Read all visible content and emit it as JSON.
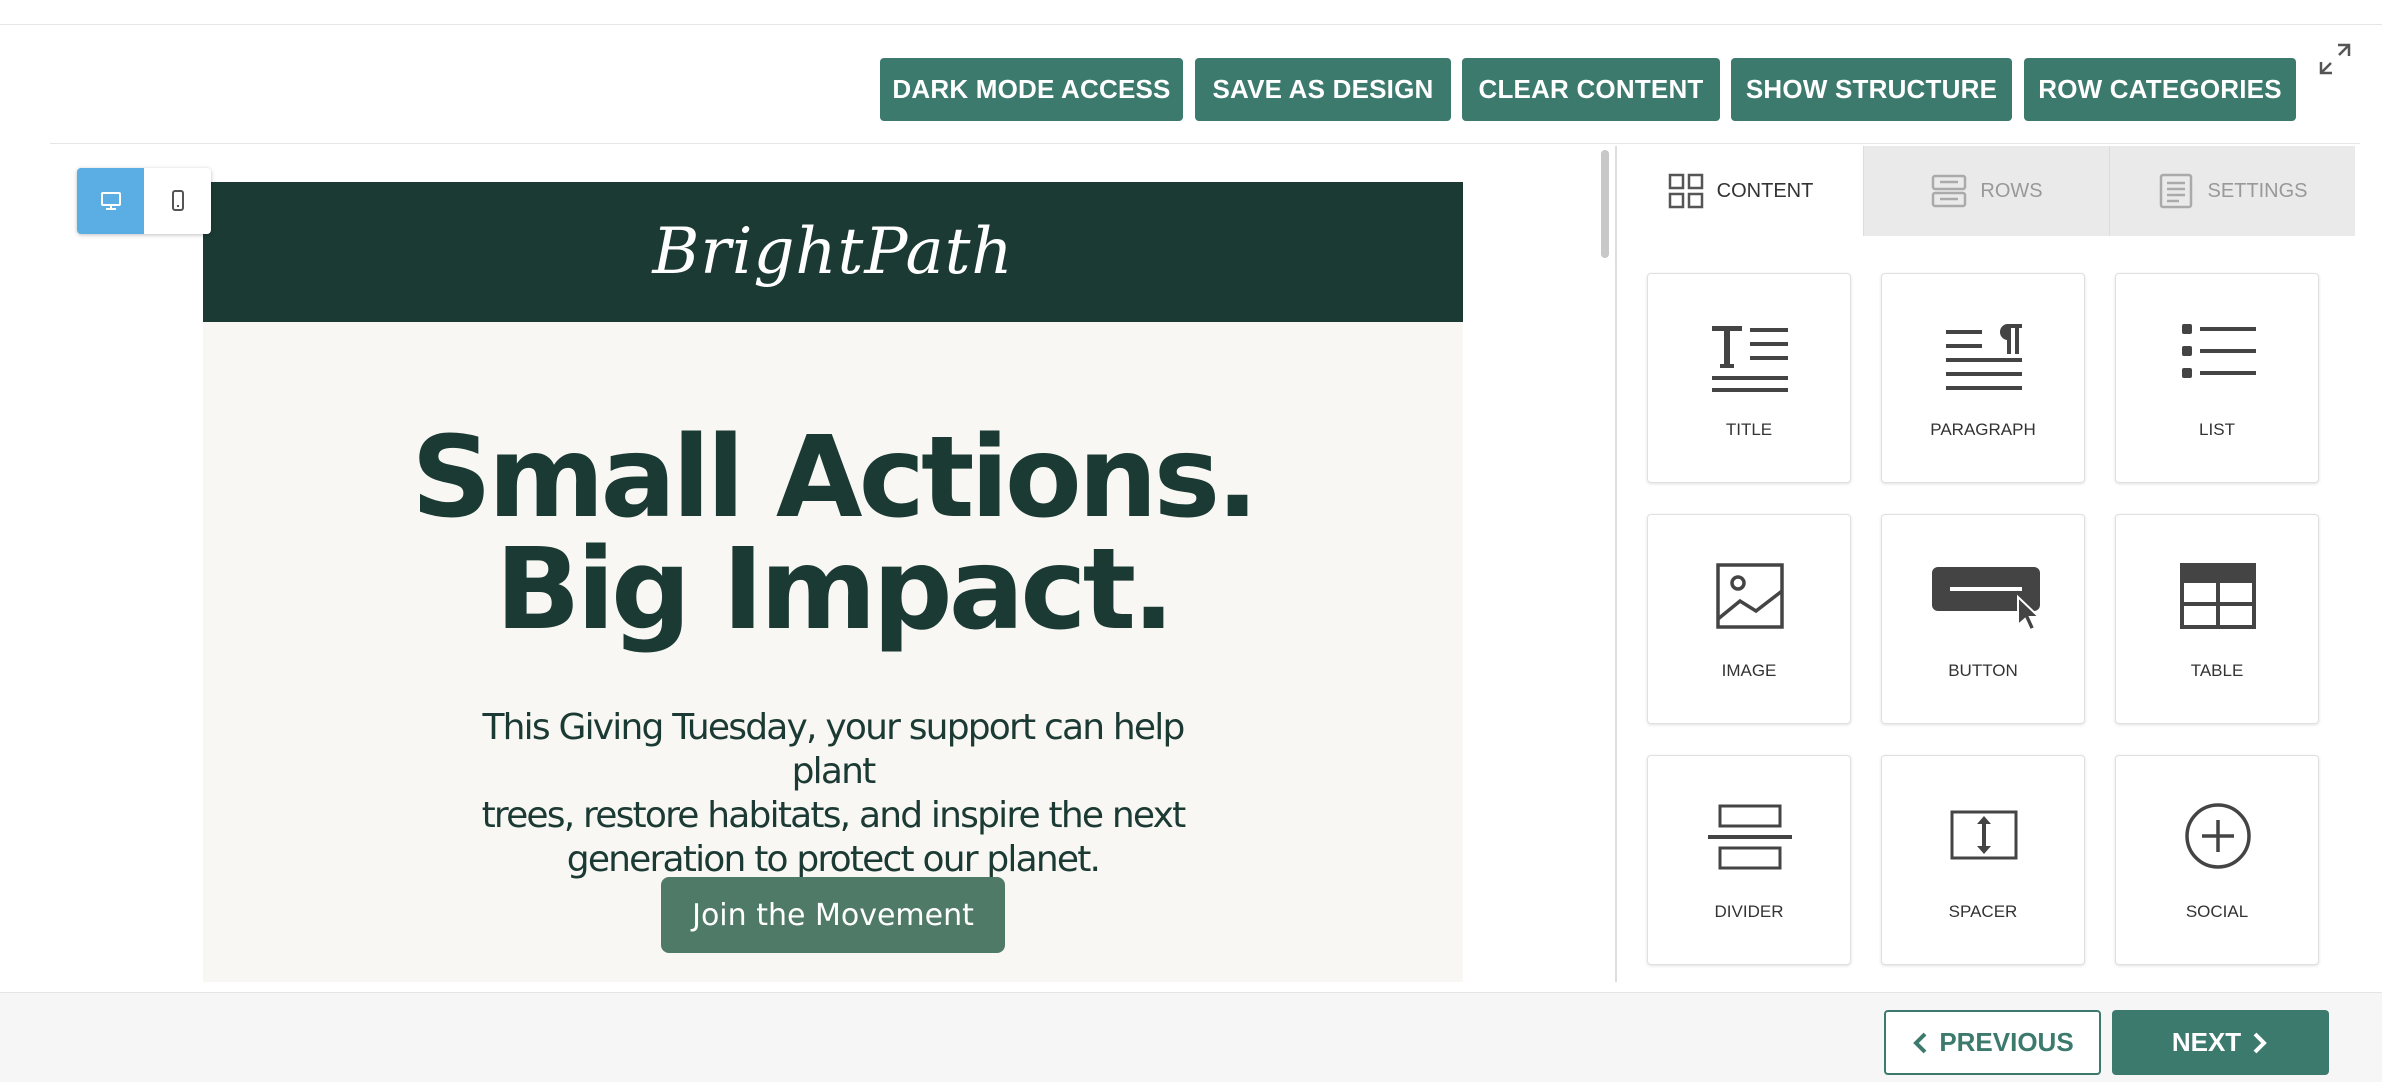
{
  "toolbar": {
    "dark_mode": "DARK MODE ACCESS",
    "save_design": "SAVE AS DESIGN",
    "clear_content": "CLEAR CONTENT",
    "show_structure": "SHOW STRUCTURE",
    "row_categories": "ROW CATEGORIES",
    "button_color": "#3d7a6e"
  },
  "device_toggle": {
    "selected": "desktop",
    "options": [
      "desktop-icon",
      "mobile-icon"
    ],
    "active_color": "#5aaee3"
  },
  "email": {
    "brand": "BrightPath",
    "headline_line1": "Small Actions.",
    "headline_line2": "Big Impact.",
    "subtext_line1": "This Giving Tuesday, your support can help plant",
    "subtext_line2": "trees, restore habitats, and inspire the next",
    "subtext_line3": "generation to protect our planet.",
    "cta_label": "Join the Movement",
    "header_color": "#1b3a33",
    "cta_color": "#507a68"
  },
  "panel": {
    "tabs": [
      {
        "label": "CONTENT",
        "icon": "grid-icon",
        "active": true
      },
      {
        "label": "ROWS",
        "icon": "rows-icon",
        "active": false
      },
      {
        "label": "SETTINGS",
        "icon": "settings-doc-icon",
        "active": false
      }
    ],
    "blocks": [
      {
        "label": "TITLE",
        "icon": "title-icon"
      },
      {
        "label": "PARAGRAPH",
        "icon": "paragraph-icon"
      },
      {
        "label": "LIST",
        "icon": "list-icon"
      },
      {
        "label": "IMAGE",
        "icon": "image-icon"
      },
      {
        "label": "BUTTON",
        "icon": "button-icon"
      },
      {
        "label": "TABLE",
        "icon": "table-icon"
      },
      {
        "label": "DIVIDER",
        "icon": "divider-icon"
      },
      {
        "label": "SPACER",
        "icon": "spacer-icon"
      },
      {
        "label": "SOCIAL",
        "icon": "social-icon"
      }
    ]
  },
  "footer": {
    "previous": "PREVIOUS",
    "next": "NEXT"
  }
}
